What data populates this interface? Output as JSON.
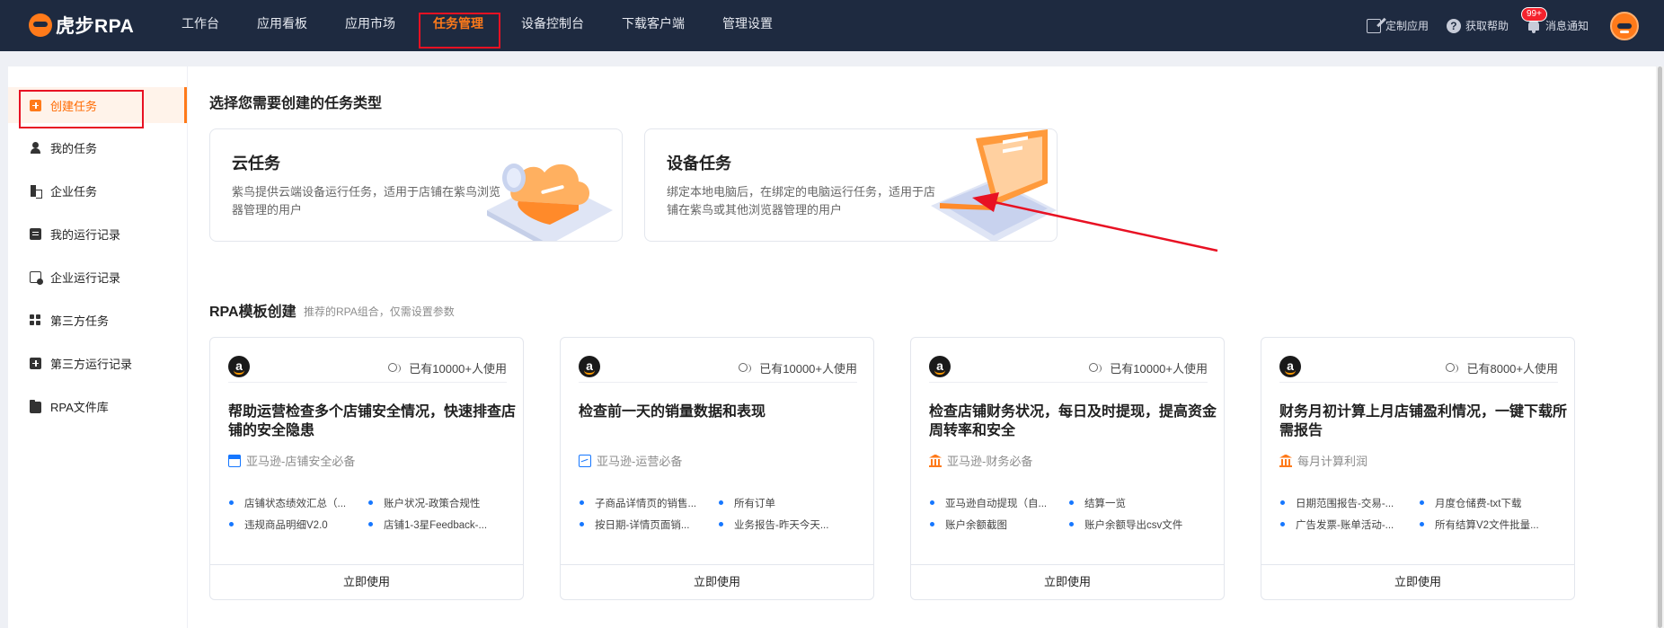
{
  "header": {
    "logo_text": "虎步RPA",
    "nav": [
      "工作台",
      "应用看板",
      "应用市场",
      "任务管理",
      "设备控制台",
      "下载客户端",
      "管理设置"
    ],
    "active_nav": "任务管理",
    "custom_app": "定制应用",
    "help": "获取帮助",
    "notifications": "消息通知",
    "badge": "99+"
  },
  "sidebar": {
    "items": [
      {
        "label": "创建任务",
        "icon": "plus-square-icon"
      },
      {
        "label": "我的任务",
        "icon": "user-icon"
      },
      {
        "label": "企业任务",
        "icon": "building-icon"
      },
      {
        "label": "我的运行记录",
        "icon": "clipboard-icon"
      },
      {
        "label": "企业运行记录",
        "icon": "document-icon"
      },
      {
        "label": "第三方任务",
        "icon": "grid-icon"
      },
      {
        "label": "第三方运行记录",
        "icon": "plus-box-icon"
      },
      {
        "label": "RPA文件库",
        "icon": "folder-icon"
      }
    ],
    "active": "创建任务"
  },
  "main": {
    "type_heading": "选择您需要创建的任务类型",
    "task_types": [
      {
        "title": "云任务",
        "desc": "紫鸟提供云端设备运行任务，适用于店铺在紫鸟浏览器管理的用户"
      },
      {
        "title": "设备任务",
        "desc": "绑定本地电脑后，在绑定的电脑运行任务，适用于店铺在紫鸟或其他浏览器管理的用户"
      }
    ],
    "template_heading": "RPA模板创建",
    "template_sub": "推荐的RPA组合，仅需设置参数",
    "templates": [
      {
        "users": "已有10000+人使用",
        "title": "帮助运营检查多个店铺安全情况，快速排查店铺的安全隐患",
        "tag": "亚马逊-店铺安全必备",
        "tag_icon": "store-icon",
        "bullets": [
          "店铺状态绩效汇总（...",
          "账户状况-政策合规性",
          "违规商品明细V2.0",
          "店铺1-3星Feedback-..."
        ],
        "button": "立即使用"
      },
      {
        "users": "已有10000+人使用",
        "title": "检查前一天的销量数据和表现",
        "tag": "亚马逊-运营必备",
        "tag_icon": "chart-icon",
        "bullets": [
          "子商品详情页的销售...",
          "所有订单",
          "按日期-详情页面销...",
          "业务报告-昨天今天..."
        ],
        "button": "立即使用"
      },
      {
        "users": "已有10000+人使用",
        "title": "检查店铺财务状况，每日及时提现，提高资金周转率和安全",
        "tag": "亚马逊-财务必备",
        "tag_icon": "bank-icon",
        "bullets": [
          "亚马逊自动提现（自...",
          "结算一览",
          "账户余额截图",
          "账户余额导出csv文件"
        ],
        "button": "立即使用"
      },
      {
        "users": "已有8000+人使用",
        "title": "财务月初计算上月店铺盈利情况，一键下载所需报告",
        "tag": "每月计算利润",
        "tag_icon": "bank-icon",
        "bullets": [
          "日期范围报告-交易-...",
          "月度仓储费-txt下载",
          "广告发票-账单活动-...",
          "所有结算V2文件批量..."
        ],
        "button": "立即使用"
      }
    ]
  },
  "colors": {
    "nav_bg": "#1e2a40",
    "accent": "#ff7a1a",
    "highlight_box": "#e81123",
    "bullet": "#1677ff"
  }
}
